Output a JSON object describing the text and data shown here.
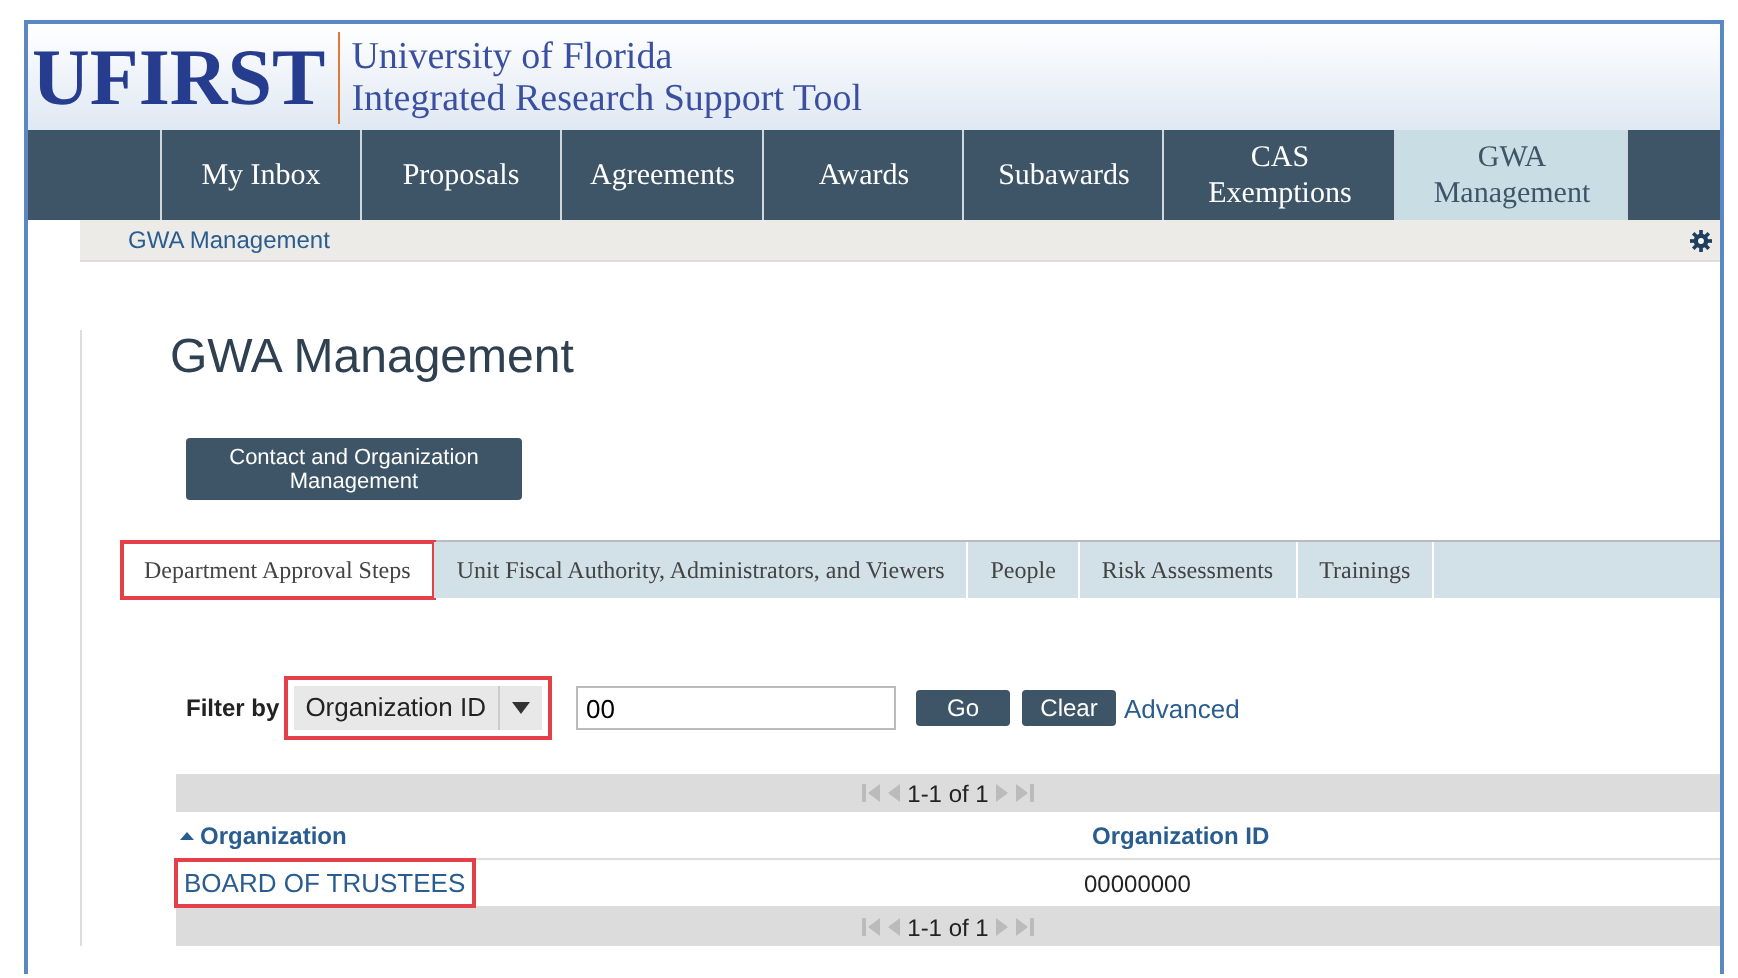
{
  "header": {
    "logo": "UFIRST",
    "title_lines": [
      "University of Florida",
      "Integrated Research Support Tool"
    ]
  },
  "nav": [
    {
      "label": "My Inbox",
      "selected": false
    },
    {
      "label": "Proposals",
      "selected": false
    },
    {
      "label": "Agreements",
      "selected": false
    },
    {
      "label": "Awards",
      "selected": false
    },
    {
      "label": "Subawards",
      "selected": false
    },
    {
      "label": "CAS Exemptions",
      "selected": false
    },
    {
      "label": "GWA Management",
      "selected": true
    }
  ],
  "breadcrumb": "GWA Management",
  "page_title": "GWA Management",
  "action_button": "Contact and Organization Management",
  "tabs": [
    {
      "label": "Department Approval Steps",
      "selected": true,
      "highlighted": true
    },
    {
      "label": "Unit Fiscal Authority, Administrators, and Viewers",
      "selected": false,
      "highlighted": false
    },
    {
      "label": "People",
      "selected": false,
      "highlighted": false
    },
    {
      "label": "Risk Assessments",
      "selected": false,
      "highlighted": false
    },
    {
      "label": "Trainings",
      "selected": false,
      "highlighted": false
    }
  ],
  "filter": {
    "label": "Filter by",
    "select": "Organization ID",
    "select_highlighted": true,
    "value": "00",
    "go": "Go",
    "clear": "Clear",
    "advanced": "Advanced"
  },
  "table": {
    "pager_top": "1-1 of 1",
    "columns": [
      {
        "label": "Organization",
        "sorted": true
      },
      {
        "label": "Organization ID",
        "sorted": false
      }
    ],
    "rows": [
      {
        "organization": "BOARD OF TRUSTEES",
        "organization_id": "00000000",
        "highlighted": true
      }
    ],
    "pager_bottom": "1-1 of 1"
  }
}
